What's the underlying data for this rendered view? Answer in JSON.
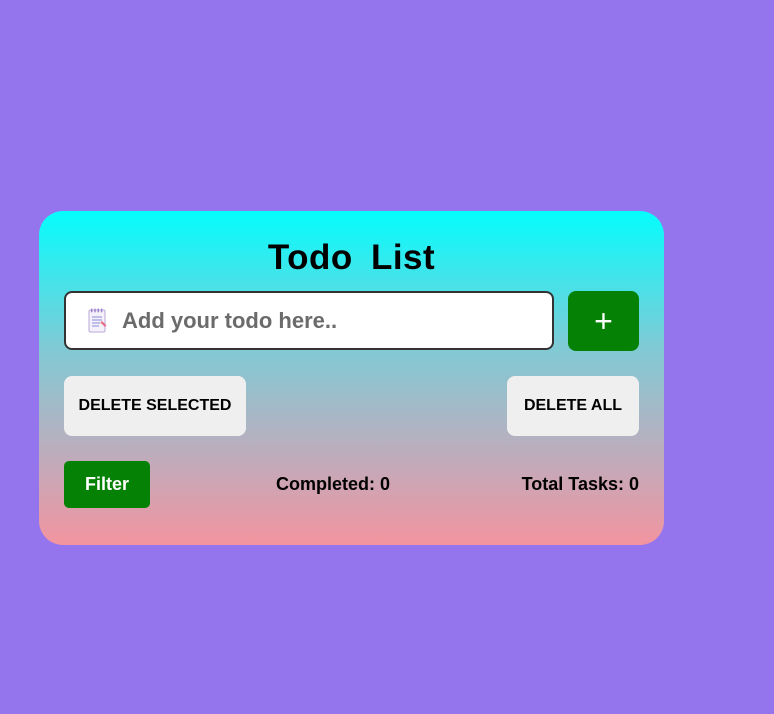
{
  "app": {
    "title": "Todo  List"
  },
  "input": {
    "placeholder": "Add your todo here..",
    "value": "",
    "icon": "notepad-icon"
  },
  "buttons": {
    "add_label": "+",
    "delete_selected_label": "DELETE SELECTED",
    "delete_all_label": "DELETE ALL",
    "filter_label": "Filter"
  },
  "stats": {
    "completed_label": "Completed: 0",
    "total_label": "Total Tasks: 0"
  },
  "colors": {
    "background": "#9575ee",
    "gradient_top": "#05fdfd",
    "gradient_bottom": "#f394a0",
    "accent_green": "#058205",
    "light_button": "#efefef"
  }
}
